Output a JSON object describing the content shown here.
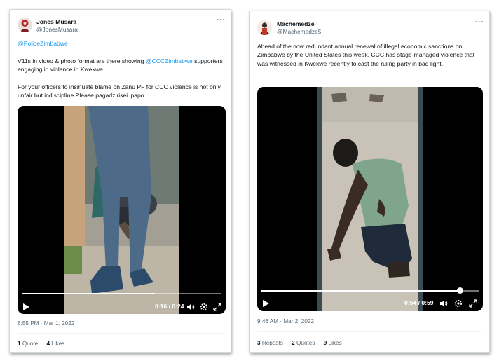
{
  "left_tweet": {
    "author_name": "Jones Musara",
    "author_handle": "@JonesMusara",
    "more_label": "···",
    "mention_1": "@PoliceZimbabwe",
    "text_1a": "V11s in video & photo format are there showing ",
    "mention_2": "@CCCZimbabwe",
    "text_1b": " supporters engaging in violence in Kwekwe.",
    "text_2": "For your officers to insinuate blame on Zanu PF for CCC violence is not only unfair but indiscipline.Please pagadzirisei ipapo.",
    "video": {
      "time": "0:16 / 0:24",
      "progress": 0.667
    },
    "timestamp": "6:55 PM · Mar 1, 2022",
    "stats": [
      {
        "count": "1",
        "label": "Quote"
      },
      {
        "count": "4",
        "label": "Likes"
      }
    ]
  },
  "right_tweet": {
    "author_name": "Machemedze",
    "author_handle": "@Machemedze5",
    "more_label": "···",
    "text": "Ahead of the now redundant annual renewal of illegal economic sanctions on Zimbabwe by the United States this week, CCC has stage-managed violence that was witnessed in Kwekwe recently to cast the ruling party in bad light.",
    "video": {
      "time": "0:54 / 0:59",
      "progress": 0.915
    },
    "timestamp": "9:46 AM · Mar 2, 2022",
    "stats": [
      {
        "count": "3",
        "label": "Reposts"
      },
      {
        "count": "2",
        "label": "Quotes"
      },
      {
        "count": "9",
        "label": "Likes"
      }
    ]
  },
  "colors": {
    "link": "#1d9bf0",
    "muted": "#536471",
    "text": "#0f1419",
    "border": "#cfd9de"
  },
  "icons": [
    "play-icon",
    "volume-icon",
    "settings-icon",
    "fullscreen-icon",
    "more-icon"
  ]
}
